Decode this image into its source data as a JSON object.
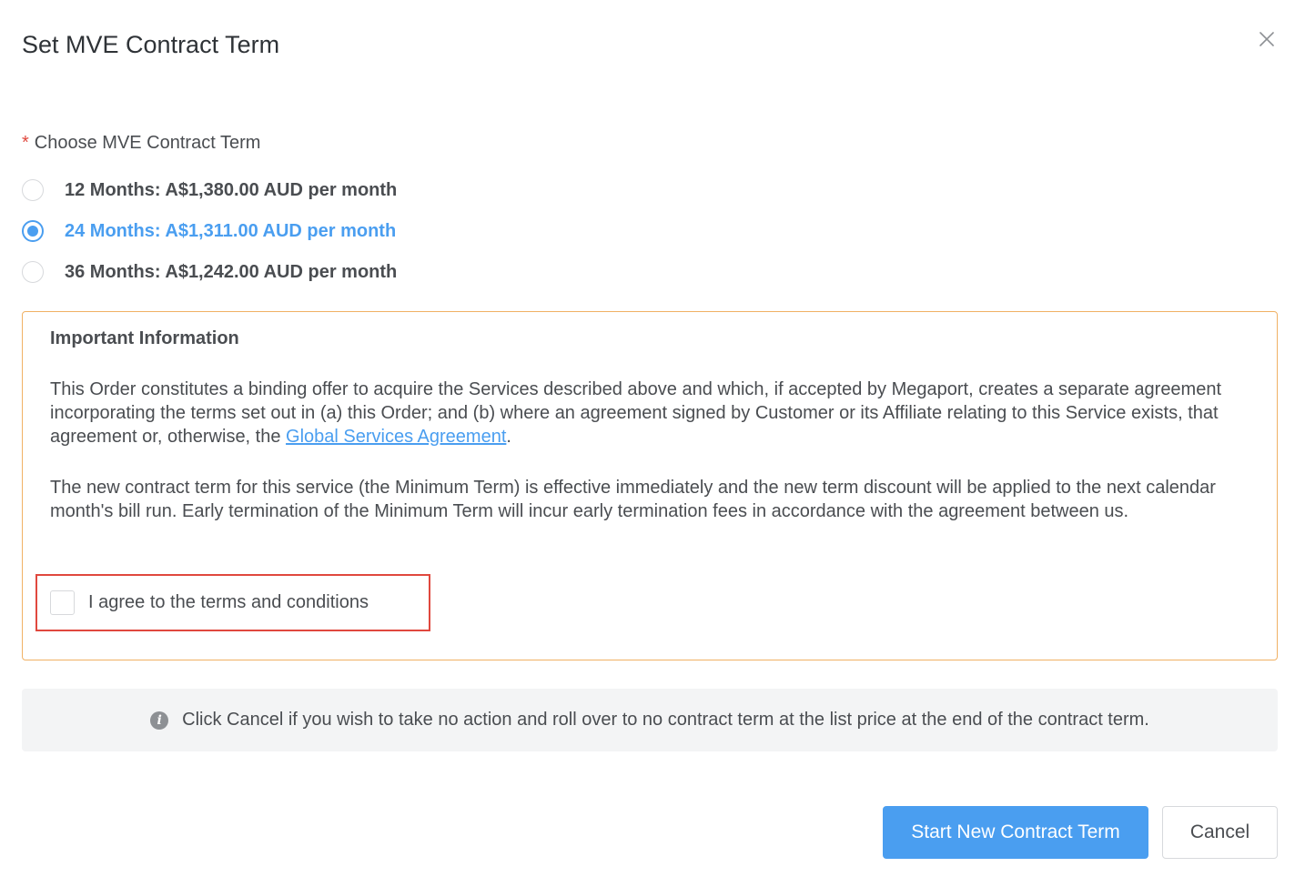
{
  "dialog": {
    "title": "Set MVE Contract Term",
    "close_icon": "close-icon"
  },
  "term_field": {
    "required_marker": "*",
    "label": "Choose MVE Contract Term",
    "options": [
      {
        "label": "12 Months: A$1,380.00 AUD per month",
        "selected": false
      },
      {
        "label": "24 Months: A$1,311.00 AUD per month",
        "selected": true
      },
      {
        "label": "36 Months: A$1,242.00 AUD per month",
        "selected": false
      }
    ]
  },
  "info_box": {
    "heading": "Important Information",
    "paragraph1_before_link": "This Order constitutes a binding offer to acquire the Services described above and which, if accepted by Megaport, creates a separate agreement incorporating the terms set out in (a) this Order; and (b) where an agreement signed by Customer or its Affiliate relating to this Service exists, that agreement or, otherwise, the ",
    "paragraph1_link": "Global Services Agreement",
    "paragraph1_after_link": ".",
    "paragraph2": "The new contract term for this service (the Minimum Term) is effective immediately and the new term discount will be applied to the next calendar month's bill run. Early termination of the Minimum Term will incur early termination fees in accordance with the agreement between us.",
    "agree_label": "I agree to the terms and conditions",
    "agree_checked": false
  },
  "notice": {
    "icon": "info-icon",
    "icon_glyph": "i",
    "text": "Click Cancel if you wish to take no action and roll over to no contract term at the list price at the end of the contract term."
  },
  "footer": {
    "primary_label": "Start New Contract Term",
    "cancel_label": "Cancel"
  },
  "colors": {
    "accent": "#4a9ef0",
    "required": "#e0483e",
    "info_border": "#f0b164",
    "highlight": "#e0483e"
  }
}
